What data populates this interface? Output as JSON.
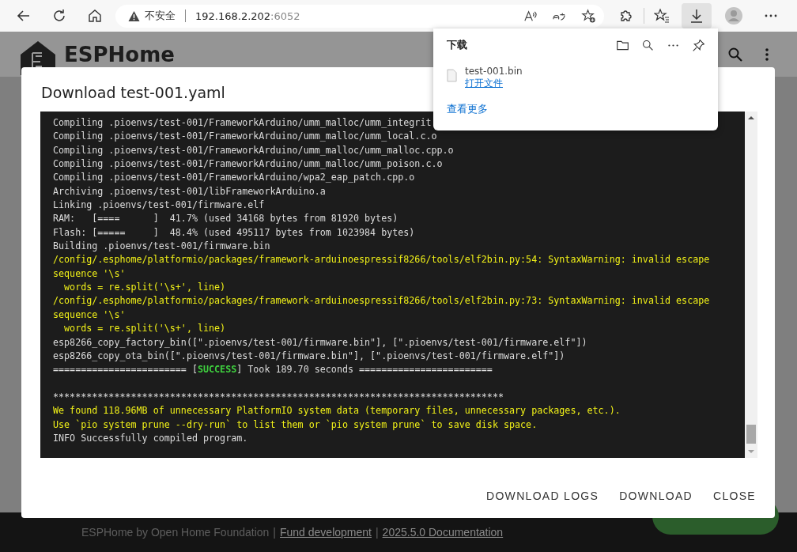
{
  "browser": {
    "security": "不安全",
    "host": "192.168.2.202",
    "port": ":6052"
  },
  "downloads_panel": {
    "title": "下载",
    "files": [
      {
        "name": "test-001.bin",
        "action": "打开文件"
      }
    ],
    "more": "查看更多"
  },
  "app": {
    "title": "ESPHome"
  },
  "dialog": {
    "title": "Download test-001.yaml",
    "log": [
      {
        "kind": "plain",
        "text": "Compiling .pioenvs/test-001/FrameworkArduino/umm_malloc/umm_integrit"
      },
      {
        "kind": "plain",
        "text": "Compiling .pioenvs/test-001/FrameworkArduino/umm_malloc/umm_local.c.o"
      },
      {
        "kind": "plain",
        "text": "Compiling .pioenvs/test-001/FrameworkArduino/umm_malloc/umm_malloc.cpp.o"
      },
      {
        "kind": "plain",
        "text": "Compiling .pioenvs/test-001/FrameworkArduino/umm_malloc/umm_poison.c.o"
      },
      {
        "kind": "plain",
        "text": "Compiling .pioenvs/test-001/FrameworkArduino/wpa2_eap_patch.cpp.o"
      },
      {
        "kind": "plain",
        "text": "Archiving .pioenvs/test-001/libFrameworkArduino.a"
      },
      {
        "kind": "plain",
        "text": "Linking .pioenvs/test-001/firmware.elf"
      },
      {
        "kind": "plain",
        "text": "RAM:   [====      ]  41.7% (used 34168 bytes from 81920 bytes)"
      },
      {
        "kind": "plain",
        "text": "Flash: [=====     ]  48.4% (used 495117 bytes from 1023984 bytes)"
      },
      {
        "kind": "plain",
        "text": "Building .pioenvs/test-001/firmware.bin"
      },
      {
        "kind": "warning",
        "text": "/config/.esphome/platformio/packages/framework-arduinoespressif8266/tools/elf2bin.py:54: SyntaxWarning: invalid escape"
      },
      {
        "kind": "warning",
        "text": "sequence '\\s'"
      },
      {
        "kind": "warning",
        "text": "  words = re.split('\\s+', line)"
      },
      {
        "kind": "warning",
        "text": "/config/.esphome/platformio/packages/framework-arduinoespressif8266/tools/elf2bin.py:73: SyntaxWarning: invalid escape"
      },
      {
        "kind": "warning",
        "text": "sequence '\\s'"
      },
      {
        "kind": "warning",
        "text": "  words = re.split('\\s+', line)"
      },
      {
        "kind": "plain",
        "text": "esp8266_copy_factory_bin([\".pioenvs/test-001/firmware.bin\"], [\".pioenvs/test-001/firmware.elf\"])"
      },
      {
        "kind": "plain",
        "text": "esp8266_copy_ota_bin([\".pioenvs/test-001/firmware.bin\"], [\".pioenvs/test-001/firmware.elf\"])"
      },
      {
        "kind": "status",
        "before": "======================== [",
        "status": "SUCCESS",
        "after": "] Took 189.70 seconds ========================"
      },
      {
        "kind": "blank"
      },
      {
        "kind": "plain",
        "text": "*********************************************************************************"
      },
      {
        "kind": "warning",
        "text": "We found 118.96MB of unnecessary PlatformIO system data (temporary files, unnecessary packages, etc.)."
      },
      {
        "kind": "warning",
        "text": "Use `pio system prune --dry-run` to list them or `pio system prune` to save disk space."
      },
      {
        "kind": "plain",
        "text": "INFO Successfully compiled program."
      }
    ],
    "buttons": [
      "DOWNLOAD LOGS",
      "DOWNLOAD",
      "CLOSE"
    ]
  },
  "footer": {
    "text": "ESPHome by Open Home Foundation",
    "links": [
      "Fund development",
      "2025.5.0 Documentation"
    ],
    "separator": "|"
  }
}
